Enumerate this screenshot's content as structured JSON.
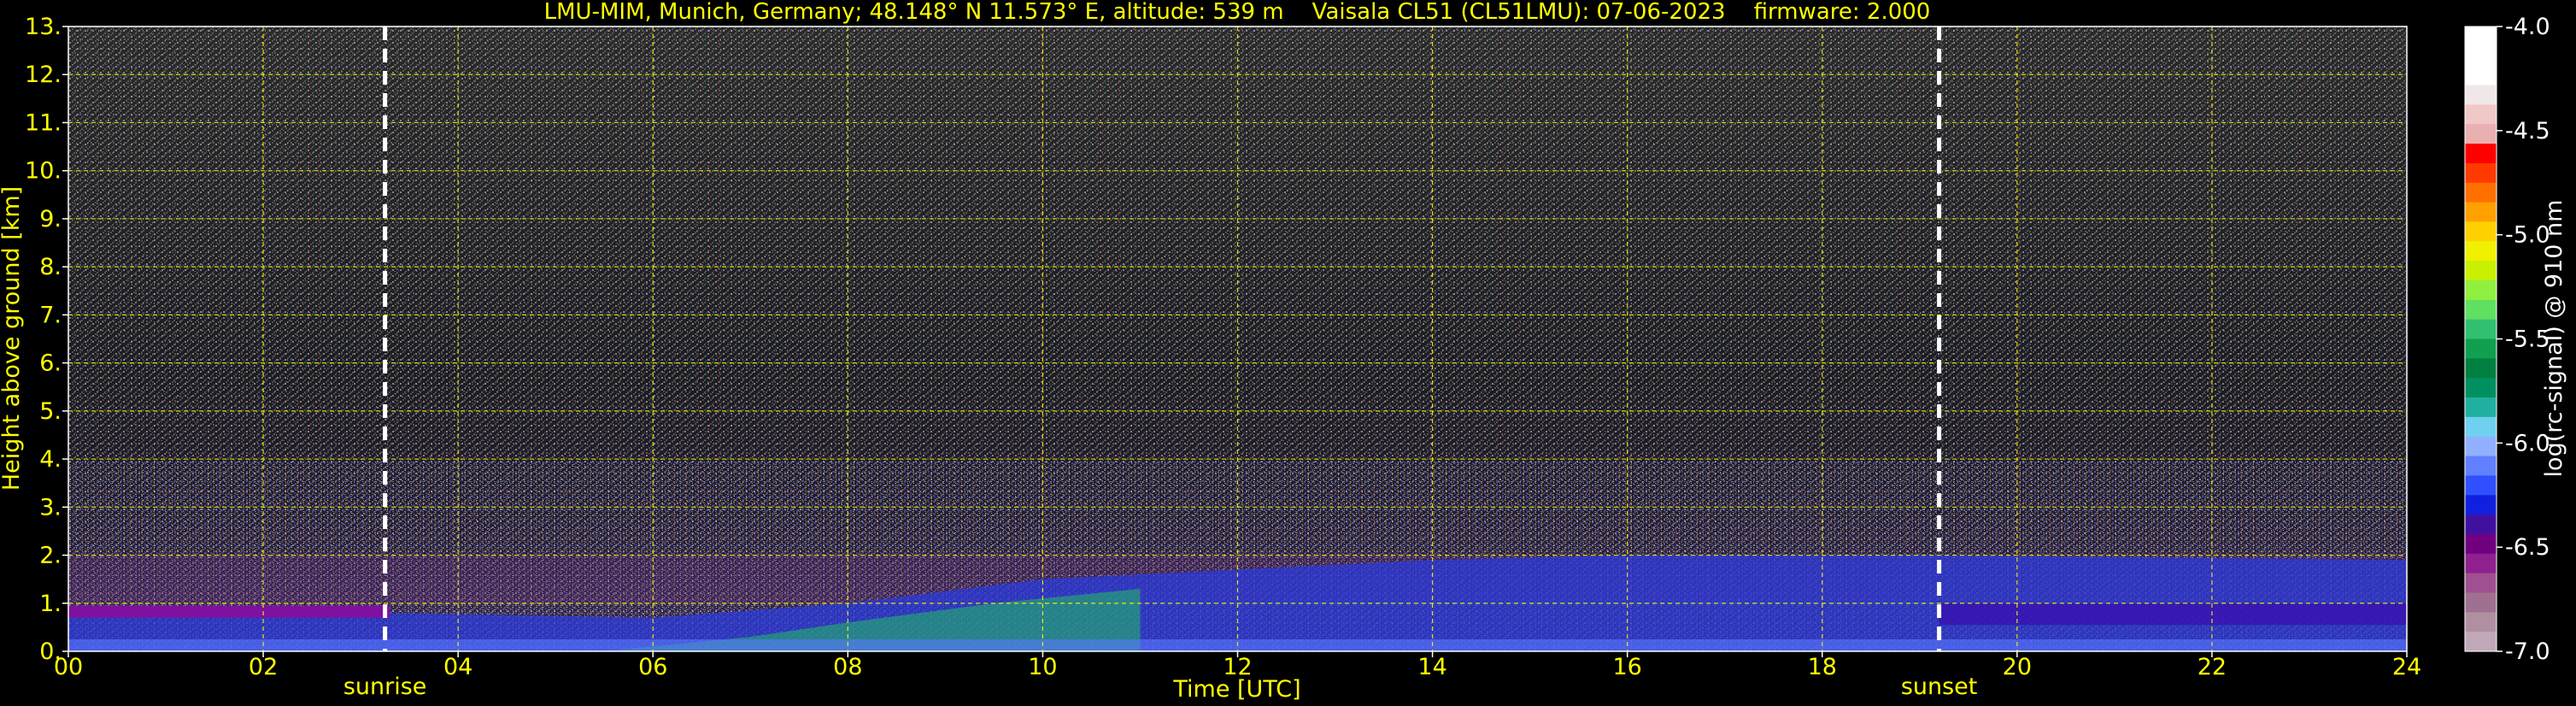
{
  "chart_data": {
    "type": "heatmap",
    "title": "LMU-MIM, Munich, Germany; 48.148° N 11.573° E, altitude: 539 m    Vaisala CL51 (CL51LMU): 07-06-2023    firmware: 2.000",
    "xlabel": "Time [UTC]",
    "ylabel": "Height above ground [km]",
    "xlim": [
      0,
      24
    ],
    "ylim": [
      0,
      13
    ],
    "xticks": [
      0,
      2,
      4,
      6,
      8,
      10,
      12,
      14,
      16,
      18,
      20,
      22,
      24
    ],
    "xtick_labels": [
      "00",
      "02",
      "04",
      "06",
      "08",
      "10",
      "12",
      "14",
      "16",
      "18",
      "20",
      "22",
      "24"
    ],
    "yticks": [
      0,
      1,
      2,
      3,
      4,
      5,
      6,
      7,
      8,
      9,
      10,
      11,
      12,
      13
    ],
    "ytick_labels": [
      "0.",
      "1.",
      "2.",
      "3.",
      "4.",
      "5.",
      "6.",
      "7.",
      "8.",
      "9.",
      "10.",
      "11.",
      "12.",
      "13."
    ],
    "grid": true,
    "annotations": [
      {
        "label": "sunrise",
        "x": 3.25
      },
      {
        "label": "sunset",
        "x": 19.2
      }
    ],
    "colorbar": {
      "label": "log(rc-signal) @ 910 nm",
      "range": [
        -7.0,
        -4.0
      ],
      "ticks": [
        -4.0,
        -4.5,
        -5.0,
        -5.5,
        -6.0,
        -6.5,
        -7.0
      ],
      "tick_labels": [
        "-4.0",
        "-4.5",
        "-5.0",
        "-5.5",
        "-6.0",
        "-6.5",
        "-7.0"
      ],
      "colors": [
        "#ffffff",
        "#ffffff",
        "#ffffff",
        "#f0e8e8",
        "#f0c8c8",
        "#e8b0b0",
        "#ff0000",
        "#ff3a00",
        "#ff7000",
        "#ffa000",
        "#ffd000",
        "#f0f000",
        "#c8f000",
        "#90f040",
        "#60e060",
        "#30c070",
        "#10a050",
        "#008040",
        "#009060",
        "#20b0a0",
        "#70d0f0",
        "#90b0ff",
        "#6080ff",
        "#3050ff",
        "#1020e0",
        "#4010a0",
        "#700080",
        "#902090",
        "#a05090",
        "#a07090",
        "#b090a0",
        "#c0a8b8"
      ]
    },
    "colors": {
      "text": "#ffff00",
      "background": "#000000",
      "grid": "#ffff00",
      "annotation_line": "#ffffff",
      "colorbar_text": "#ffffff"
    }
  }
}
